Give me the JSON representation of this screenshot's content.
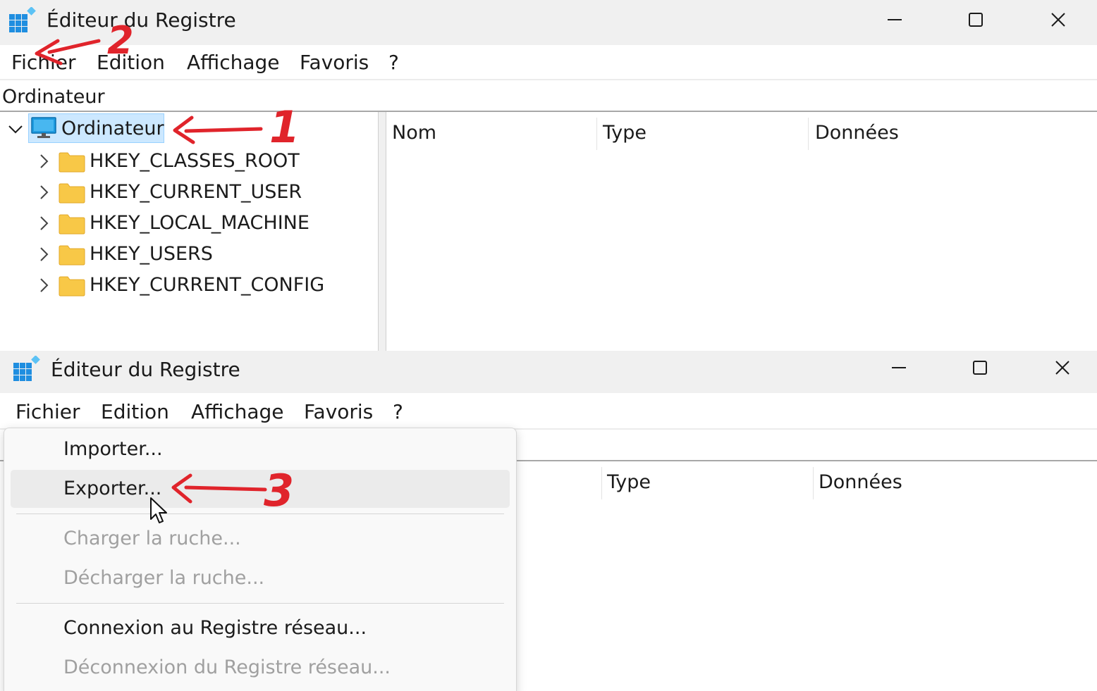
{
  "window_top": {
    "title": "Éditeur du Registre",
    "menu": [
      "Fichier",
      "Edition",
      "Affichage",
      "Favoris",
      "?"
    ],
    "address": "Ordinateur",
    "tree": {
      "root": "Ordinateur",
      "children": [
        "HKEY_CLASSES_ROOT",
        "HKEY_CURRENT_USER",
        "HKEY_LOCAL_MACHINE",
        "HKEY_USERS",
        "HKEY_CURRENT_CONFIG"
      ]
    },
    "columns": [
      "Nom",
      "Type",
      "Données"
    ]
  },
  "window_bottom": {
    "title": "Éditeur du Registre",
    "menu": [
      "Fichier",
      "Edition",
      "Affichage",
      "Favoris",
      "?"
    ],
    "columns": [
      "Type",
      "Données"
    ],
    "file_menu": {
      "items": [
        {
          "label": "Importer...",
          "enabled": true
        },
        {
          "label": "Exporter...",
          "enabled": true,
          "hovered": true
        },
        {
          "label": "Charger la ruche...",
          "enabled": false
        },
        {
          "label": "Décharger la ruche...",
          "enabled": false
        },
        {
          "label": "Connexion au Registre réseau...",
          "enabled": true
        },
        {
          "label": "Déconnexion du Registre réseau...",
          "enabled": false
        }
      ]
    }
  },
  "annotations": {
    "numbers": [
      "1",
      "2",
      "3"
    ],
    "color": "#e0242b"
  },
  "colors": {
    "titlebar": "#f0f0f0",
    "selection": "#cce8ff",
    "folder": "#f8c847",
    "monitor": "#1e9be0",
    "disabled_text": "#a0a0a0"
  },
  "icons": [
    "regedit-icon",
    "minimize-icon",
    "maximize-icon",
    "close-icon",
    "chevron-down-icon",
    "chevron-right-icon",
    "computer-icon",
    "folder-icon",
    "mouse-cursor-icon"
  ]
}
